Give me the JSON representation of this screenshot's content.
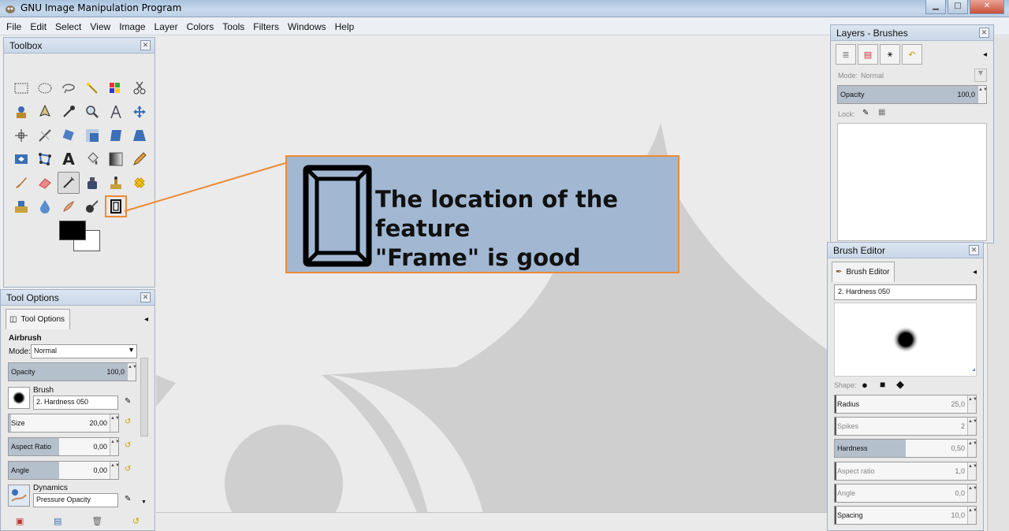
{
  "window": {
    "title": "GNU Image Manipulation Program"
  },
  "menubar": [
    "File",
    "Edit",
    "Select",
    "View",
    "Image",
    "Layer",
    "Colors",
    "Tools",
    "Filters",
    "Windows",
    "Help"
  ],
  "toolbox": {
    "title": "Toolbox"
  },
  "tool_options": {
    "title": "Tool Options",
    "tab_label": "Tool Options",
    "tool_name": "Airbrush",
    "mode_label": "Mode:",
    "mode_value": "Normal",
    "opacity": {
      "label": "Opacity",
      "value": "100,0"
    },
    "brush": {
      "label": "Brush",
      "value": "2. Hardness 050"
    },
    "size": {
      "label": "Size",
      "value": "20,00"
    },
    "aspect_ratio": {
      "label": "Aspect Ratio",
      "value": "0,00"
    },
    "angle": {
      "label": "Angle",
      "value": "0,00"
    },
    "dynamics": {
      "label": "Dynamics",
      "value": "Pressure Opacity"
    }
  },
  "layers_panel": {
    "title": "Layers - Brushes",
    "mode_label": "Mode:",
    "mode_value": "Normal",
    "opacity": {
      "label": "Opacity",
      "value": "100,0"
    },
    "lock_label": "Lock:"
  },
  "brush_editor": {
    "title": "Brush Editor",
    "tab_label": "Brush Editor",
    "brush_name": "2. Hardness 050",
    "shape_label": "Shape:",
    "params": [
      {
        "label": "Radius",
        "value": "25,0",
        "fill": 0.01
      },
      {
        "label": "Spikes",
        "value": "2",
        "fill": 0.0
      },
      {
        "label": "Hardness",
        "value": "0,50",
        "fill": 0.5
      },
      {
        "label": "Aspect ratio",
        "value": "1,0",
        "fill": 0.0
      },
      {
        "label": "Angle",
        "value": "0,0",
        "fill": 0.0
      },
      {
        "label": "Spacing",
        "value": "10,0",
        "fill": 0.01
      }
    ]
  },
  "callout": {
    "line1": "The location of the feature",
    "line2": "\"Frame\" is good"
  },
  "colors": {
    "accent": "#ec8b36",
    "callout_bg": "#a2b8d2",
    "fg_color": "#000000",
    "bg_color": "#ffffff"
  }
}
